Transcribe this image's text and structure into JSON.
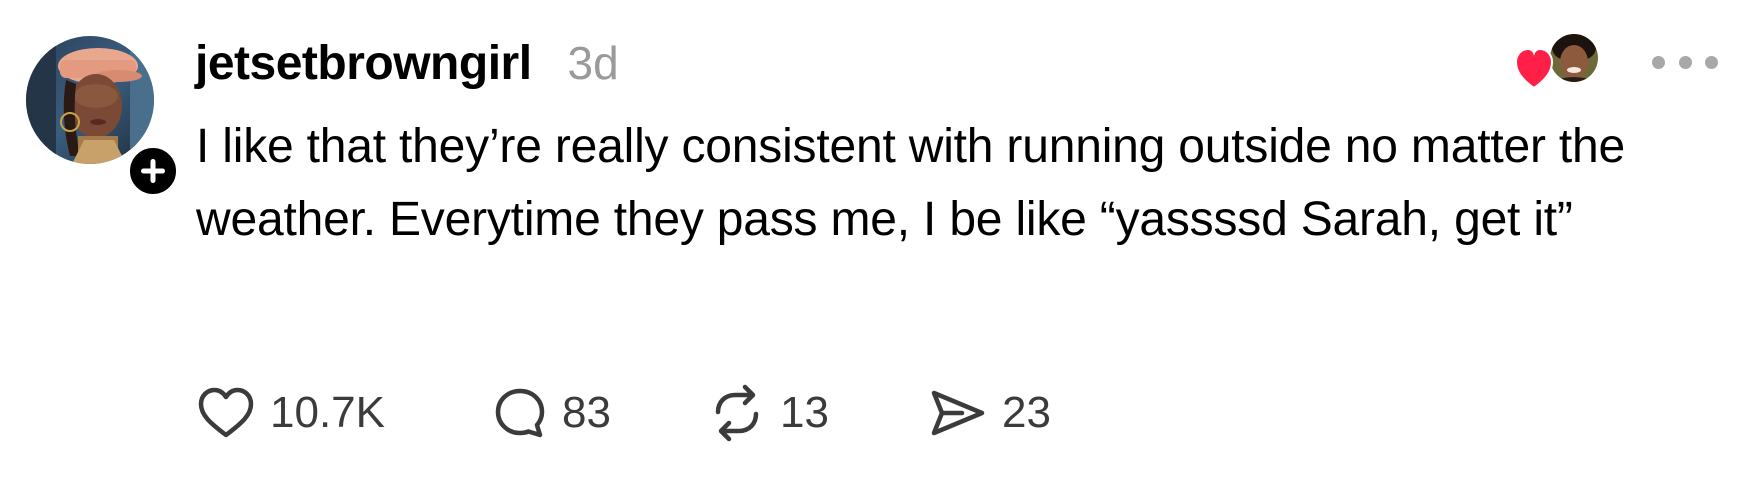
{
  "post": {
    "author": {
      "username": "jetsetbrowngirl",
      "avatar_icon": "profile-photo",
      "follow_icon": "plus-icon"
    },
    "timestamp": "3d",
    "liked_by_icon": "heart-icon",
    "more_icon": "more-horizontal-icon",
    "text": "I like that they’re really consistent with running outside no matter the weather. Everytime they pass me, I be like “yassssd Sarah, get it”",
    "actions": {
      "like": {
        "icon": "heart-outline-icon",
        "count": "10.7K"
      },
      "reply": {
        "icon": "comment-icon",
        "count": "83"
      },
      "repost": {
        "icon": "repost-icon",
        "count": "13"
      },
      "share": {
        "icon": "send-icon",
        "count": "23"
      }
    },
    "colors": {
      "text": "#000000",
      "muted": "#9a9a9a",
      "action_text": "#3b3b3b",
      "heart_red": "#ff1f47"
    }
  }
}
